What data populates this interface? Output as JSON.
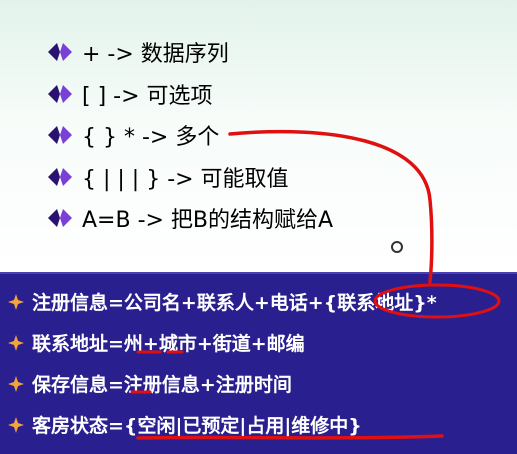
{
  "notation_list": [
    {
      "text": "+  -> 数据序列"
    },
    {
      "text": "[ ] -> 可选项"
    },
    {
      "text": "{ } * -> 多个"
    },
    {
      "text": "{ | | | } -> 可能取值"
    },
    {
      "text": "A=B -> 把B的结构赋给A"
    }
  ],
  "definitions": [
    {
      "text": "注册信息=公司名+联系人+电话+{联系地址}*"
    },
    {
      "text": "联系地址=州+城市+街道+邮编"
    },
    {
      "text": "保存信息=注册信息+注册时间"
    },
    {
      "text": "客房状态={空闲|已预定|占用|维修中}"
    }
  ],
  "colors": {
    "bullet_purple": "#5b2bb5",
    "bullet_dark": "#2a1370",
    "panel_blue": "#2a1f8f",
    "star_orange": "#f2a53a",
    "annotation_red": "#e01010"
  },
  "icons": {
    "list_bullet": "diamond-bullet-icon",
    "def_bullet": "four-point-star-icon"
  }
}
